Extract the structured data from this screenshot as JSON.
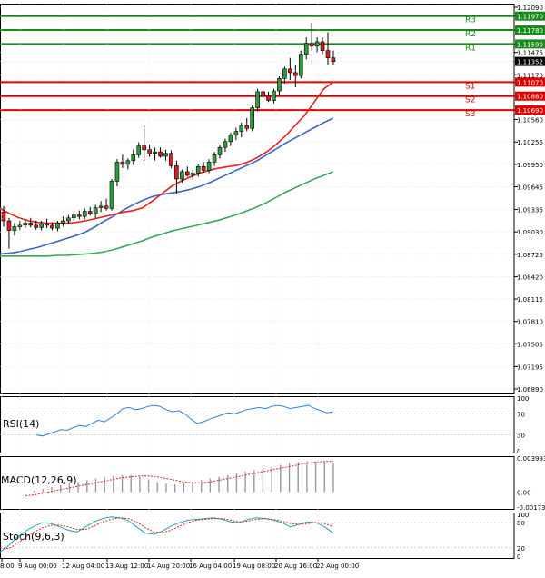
{
  "chart_data": {
    "type": "candlestick",
    "panels": [
      "price",
      "rsi",
      "macd",
      "stoch"
    ],
    "x_tick_labels": [
      "8:00",
      "9 Aug 00:00",
      "12 Aug 04:00",
      "13 Aug 12:00",
      "14 Aug 20:00",
      "16 Aug 04:00",
      "19 Aug 08:00",
      "20 Aug 16:00",
      "22 Aug 00:00"
    ],
    "price": {
      "ylim": [
        1.0689,
        1.1209
      ],
      "y_ticks": [
        "1.12090",
        "1.11970",
        "1.11780",
        "1.11590",
        "1.11475",
        "1.11352",
        "1.11170",
        "1.11070",
        "1.10880",
        "1.10690",
        "1.10560",
        "1.10255",
        "1.09950",
        "1.09645",
        "1.09335",
        "1.09030",
        "1.08725",
        "1.08420",
        "1.08115",
        "1.07810",
        "1.07505",
        "1.07195",
        "1.06890"
      ],
      "current_price": "1.11352",
      "levels": [
        {
          "name": "R3",
          "value": 1.1197,
          "label": "1.11970",
          "color": "#1a8a1a"
        },
        {
          "name": "R2",
          "value": 1.1178,
          "label": "1.11780",
          "color": "#1a8a1a"
        },
        {
          "name": "R1",
          "value": 1.1159,
          "label": "1.11590",
          "color": "#1a8a1a"
        },
        {
          "name": "S1",
          "value": 1.1107,
          "label": "1.11070",
          "color": "#e00000"
        },
        {
          "name": "S2",
          "value": 1.1088,
          "label": "1.10880",
          "color": "#e00000"
        },
        {
          "name": "S3",
          "value": 1.1069,
          "label": "1.10690",
          "color": "#e00000"
        }
      ],
      "candles": [
        [
          1.093,
          1.0938,
          1.091,
          1.0918
        ],
        [
          1.0918,
          1.0922,
          1.088,
          1.0905
        ],
        [
          1.0905,
          1.0915,
          1.0898,
          1.091
        ],
        [
          1.091,
          1.0918,
          1.0905,
          1.0912
        ],
        [
          1.0912,
          1.092,
          1.0908,
          1.0915
        ],
        [
          1.0915,
          1.0922,
          1.0909,
          1.0912
        ],
        [
          1.0912,
          1.0918,
          1.0906,
          1.0909
        ],
        [
          1.0909,
          1.0918,
          1.0905,
          1.0914
        ],
        [
          1.0914,
          1.0921,
          1.0908,
          1.0912
        ],
        [
          1.0912,
          1.0916,
          1.0905,
          1.0908
        ],
        [
          1.0908,
          1.0918,
          1.0904,
          1.0915
        ],
        [
          1.0915,
          1.0924,
          1.091,
          1.0918
        ],
        [
          1.0918,
          1.0926,
          1.0914,
          1.0922
        ],
        [
          1.0922,
          1.093,
          1.0918,
          1.0926
        ],
        [
          1.0926,
          1.0932,
          1.092,
          1.0924
        ],
        [
          1.0924,
          1.0935,
          1.092,
          1.0931
        ],
        [
          1.0931,
          1.0937,
          1.0925,
          1.0928
        ],
        [
          1.0928,
          1.094,
          1.0922,
          1.0936
        ],
        [
          1.0936,
          1.0945,
          1.093,
          1.0938
        ],
        [
          1.0938,
          1.0948,
          1.0932,
          1.0935
        ],
        [
          1.0935,
          1.0975,
          1.0932,
          1.0972
        ],
        [
          1.0972,
          1.1002,
          1.0965,
          1.0998
        ],
        [
          1.0998,
          1.1008,
          1.099,
          1.0995
        ],
        [
          1.0995,
          1.1003,
          1.0988,
          1.1
        ],
        [
          1.1,
          1.1015,
          1.0994,
          1.1008
        ],
        [
          1.1008,
          1.1025,
          1.1004,
          1.102
        ],
        [
          1.102,
          1.1048,
          1.1,
          1.1015
        ],
        [
          1.1015,
          1.1022,
          1.1005,
          1.101
        ],
        [
          1.101,
          1.1018,
          1.1,
          1.1012
        ],
        [
          1.1012,
          1.1018,
          1.1004,
          1.1006
        ],
        [
          1.1006,
          1.1015,
          1.1,
          1.101
        ],
        [
          1.101,
          1.1014,
          1.099,
          1.0993
        ],
        [
          1.0993,
          1.1,
          1.0955,
          1.0975
        ],
        [
          1.0975,
          1.0988,
          1.097,
          1.0985
        ],
        [
          1.0985,
          1.0992,
          1.0978,
          1.098
        ],
        [
          1.098,
          1.0988,
          1.0974,
          1.0983
        ],
        [
          1.0983,
          1.0995,
          1.0978,
          1.0992
        ],
        [
          1.0992,
          1.0998,
          1.0984,
          1.0987
        ],
        [
          1.0987,
          1.1002,
          1.0983,
          1.0998
        ],
        [
          1.0998,
          1.1012,
          1.0993,
          1.1008
        ],
        [
          1.1008,
          1.1022,
          1.1003,
          1.1018
        ],
        [
          1.1018,
          1.103,
          1.1012,
          1.1026
        ],
        [
          1.1026,
          1.1038,
          1.102,
          1.1035
        ],
        [
          1.1035,
          1.1045,
          1.1028,
          1.104
        ],
        [
          1.104,
          1.1052,
          1.1032,
          1.1048
        ],
        [
          1.1048,
          1.1058,
          1.104,
          1.1044
        ],
        [
          1.1044,
          1.1075,
          1.104,
          1.1072
        ],
        [
          1.1072,
          1.1098,
          1.1067,
          1.1094
        ],
        [
          1.1094,
          1.1098,
          1.1085,
          1.1088
        ],
        [
          1.1088,
          1.1094,
          1.108,
          1.1082
        ],
        [
          1.1082,
          1.1098,
          1.1078,
          1.1095
        ],
        [
          1.1095,
          1.1115,
          1.109,
          1.1112
        ],
        [
          1.1112,
          1.1128,
          1.1105,
          1.1125
        ],
        [
          1.1125,
          1.114,
          1.111,
          1.112
        ],
        [
          1.112,
          1.113,
          1.11,
          1.1116
        ],
        [
          1.1116,
          1.115,
          1.1112,
          1.1145
        ],
        [
          1.1145,
          1.1168,
          1.1138,
          1.116
        ],
        [
          1.116,
          1.1188,
          1.115,
          1.1156
        ],
        [
          1.1156,
          1.1168,
          1.1148,
          1.1162
        ],
        [
          1.1162,
          1.1168,
          1.1145,
          1.115
        ],
        [
          1.115,
          1.1175,
          1.113,
          1.114
        ],
        [
          1.114,
          1.115,
          1.113,
          1.1135
        ]
      ],
      "ma_red": [
        1.0935,
        1.0928,
        1.0922,
        1.0918,
        1.0916,
        1.0915,
        1.0915,
        1.0915,
        1.0916,
        1.0918,
        1.0921,
        1.0924,
        1.0927,
        1.093,
        1.0932,
        1.0936,
        1.0945,
        1.0955,
        1.0965,
        1.0972,
        1.0978,
        1.0983,
        1.0987,
        1.099,
        1.0992,
        1.0994,
        1.0998,
        1.1004,
        1.1012,
        1.1022,
        1.1034,
        1.1048,
        1.1062,
        1.108,
        1.1098,
        1.1107
      ],
      "ma_blue": [
        1.0873,
        1.0874,
        1.0876,
        1.0879,
        1.0882,
        1.0886,
        1.089,
        1.0894,
        1.0898,
        1.0903,
        1.091,
        1.0918,
        1.0925,
        1.0933,
        1.094,
        1.0946,
        1.0951,
        1.0954,
        1.0956,
        1.0958,
        1.0961,
        1.0965,
        1.097,
        1.0976,
        1.0982,
        1.0988,
        1.0994,
        1.1,
        1.1008,
        1.1016,
        1.1024,
        1.1031,
        1.1038,
        1.1045,
        1.1052,
        1.1058
      ],
      "ma_green": [
        1.087,
        1.087,
        1.087,
        1.087,
        1.087,
        1.087,
        1.0871,
        1.0871,
        1.0872,
        1.0873,
        1.0874,
        1.0876,
        1.0879,
        1.0883,
        1.0887,
        1.0891,
        1.0896,
        1.09,
        1.0904,
        1.0907,
        1.091,
        1.0913,
        1.0916,
        1.0919,
        1.0923,
        1.0927,
        1.0932,
        1.0937,
        1.0943,
        1.095,
        1.0957,
        1.0963,
        1.0969,
        1.0975,
        1.098,
        1.0985
      ]
    },
    "rsi": {
      "label": "RSI(14)",
      "ylim": [
        0,
        100
      ],
      "y_ticks": [
        "100",
        "70",
        "30",
        "0"
      ],
      "values": [
        30,
        28,
        32,
        36,
        40,
        39,
        44,
        48,
        46,
        52,
        58,
        55,
        62,
        70,
        80,
        82,
        78,
        80,
        84,
        86,
        84,
        78,
        74,
        76,
        70,
        60,
        52,
        55,
        60,
        64,
        68,
        72,
        70,
        74,
        78,
        80,
        82,
        80,
        84,
        86,
        84,
        80,
        82,
        84,
        86,
        80,
        76,
        72,
        74
      ]
    },
    "macd": {
      "label": "MACD(12,26,9)",
      "ylim": [
        -0.001734,
        0.003993
      ],
      "y_ticks": [
        "0.003993",
        "0.00",
        "-0.001734"
      ],
      "histogram": [
        0.0,
        0.0002,
        0.0004,
        0.0006,
        0.0008,
        0.001,
        0.0012,
        0.0014,
        0.0016,
        0.0018,
        0.0019,
        0.002,
        0.002,
        0.0018,
        0.0015,
        0.0012,
        0.001,
        0.0009,
        0.001,
        0.0012,
        0.0014,
        0.0016,
        0.0018,
        0.002,
        0.0022,
        0.0024,
        0.0026,
        0.0028,
        0.003,
        0.0032,
        0.0034,
        0.0035,
        0.0036,
        0.0036,
        0.0035,
        0.0034
      ],
      "signal": [
        -0.0004,
        -0.0003,
        -0.0001,
        0.0001,
        0.0003,
        0.0005,
        0.0007,
        0.0009,
        0.0011,
        0.0013,
        0.0015,
        0.0017,
        0.0018,
        0.0019,
        0.0019,
        0.0018,
        0.0016,
        0.0014,
        0.0012,
        0.0011,
        0.0011,
        0.0012,
        0.0014,
        0.0016,
        0.0018,
        0.002,
        0.0022,
        0.0024,
        0.0026,
        0.0028,
        0.003,
        0.0032,
        0.0034,
        0.0035,
        0.0036,
        0.0036
      ]
    },
    "stoch": {
      "label": "Stoch(9,6,3)",
      "ylim": [
        0,
        100
      ],
      "y_ticks": [
        "100",
        "80",
        "20",
        "0"
      ],
      "main": [
        10,
        25,
        45,
        60,
        72,
        80,
        78,
        70,
        62,
        58,
        70,
        82,
        90,
        94,
        92,
        85,
        70,
        55,
        52,
        60,
        72,
        80,
        86,
        88,
        90,
        92,
        88,
        82,
        80,
        88,
        92,
        90,
        86,
        80,
        70,
        76,
        82,
        80,
        70,
        55
      ],
      "signal": [
        20,
        18,
        30,
        45,
        58,
        68,
        74,
        74,
        70,
        64,
        64,
        72,
        82,
        88,
        92,
        90,
        82,
        68,
        58,
        56,
        62,
        72,
        80,
        86,
        88,
        90,
        90,
        86,
        82,
        84,
        88,
        90,
        88,
        84,
        78,
        76,
        78,
        80,
        78,
        70
      ]
    }
  }
}
